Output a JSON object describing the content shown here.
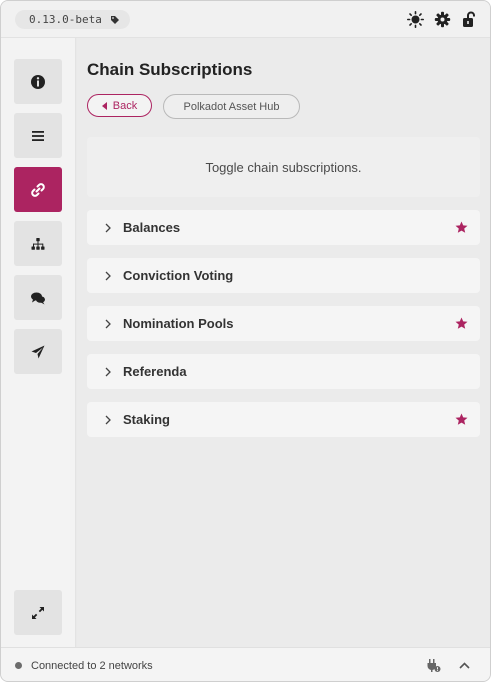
{
  "app": {
    "version": "0.13.0-beta"
  },
  "topbar": {
    "icons": [
      "tag-icon",
      "sun-icon",
      "gear-icon",
      "unlock-icon"
    ]
  },
  "sidebar": {
    "items": [
      {
        "name": "info",
        "icon": "info-circle-icon",
        "active": false
      },
      {
        "name": "menu",
        "icon": "list-icon",
        "active": false
      },
      {
        "name": "subscriptions",
        "icon": "link-icon",
        "active": true
      },
      {
        "name": "network",
        "icon": "sitemap-icon",
        "active": false
      },
      {
        "name": "chat",
        "icon": "comments-icon",
        "active": false
      },
      {
        "name": "send",
        "icon": "paper-plane-icon",
        "active": false
      }
    ],
    "bottom_icon": "expand-icon"
  },
  "main": {
    "title": "Chain Subscriptions",
    "back_label": "Back",
    "chain_label": "Polkadot Asset Hub",
    "info_text": "Toggle chain subscriptions.",
    "subscriptions": [
      {
        "label": "Balances",
        "starred": true
      },
      {
        "label": "Conviction Voting",
        "starred": false
      },
      {
        "label": "Nomination Pools",
        "starred": true
      },
      {
        "label": "Referenda",
        "starred": false
      },
      {
        "label": "Staking",
        "starred": true
      }
    ]
  },
  "statusbar": {
    "text": "Connected to 2 networks"
  },
  "colors": {
    "accent": "#ac2461",
    "background": "#ebebeb",
    "card": "#f5f5f5"
  }
}
